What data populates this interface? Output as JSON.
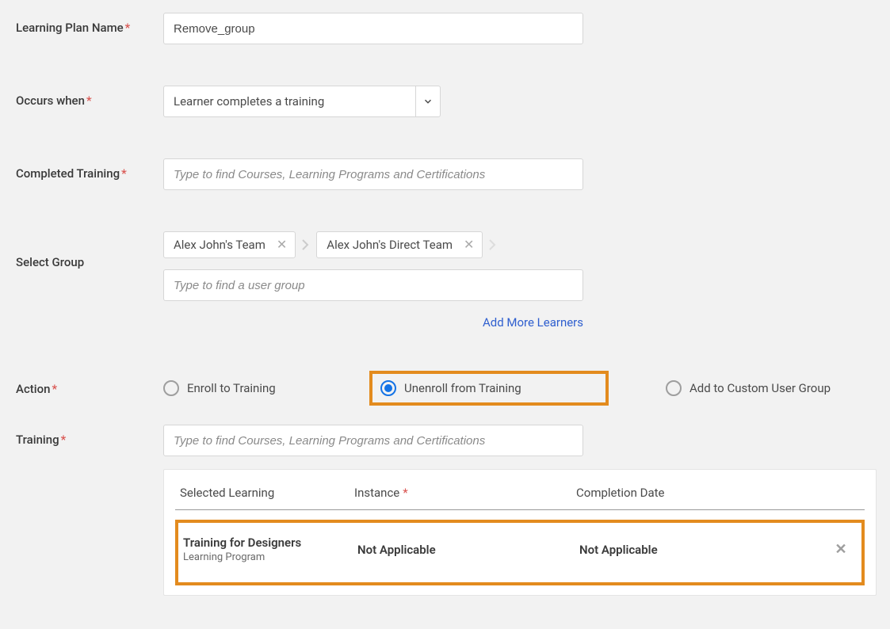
{
  "labels": {
    "learningPlanName": "Learning Plan Name",
    "occursWhen": "Occurs when",
    "completedTraining": "Completed Training",
    "selectGroup": "Select Group",
    "action": "Action",
    "training": "Training"
  },
  "values": {
    "learningPlanName": "Remove_group",
    "occursWhen": "Learner completes a training"
  },
  "placeholders": {
    "completedTraining": "Type to find Courses, Learning Programs and Certifications",
    "selectGroup": "Type to find a user group",
    "training": "Type to find Courses, Learning Programs and Certifications"
  },
  "groupChips": [
    "Alex John's Team",
    "Alex John's Direct Team"
  ],
  "addMoreLearners": "Add More Learners",
  "actions": {
    "enroll": "Enroll to Training",
    "unenroll": "Unenroll from Training",
    "addToGroup": "Add to Custom User Group"
  },
  "panel": {
    "headers": {
      "selectedLearning": "Selected Learning",
      "instance": "Instance",
      "completionDate": "Completion Date"
    },
    "row": {
      "title": "Training for Designers",
      "subtitle": "Learning Program",
      "instance": "Not Applicable",
      "completion": "Not Applicable"
    }
  }
}
